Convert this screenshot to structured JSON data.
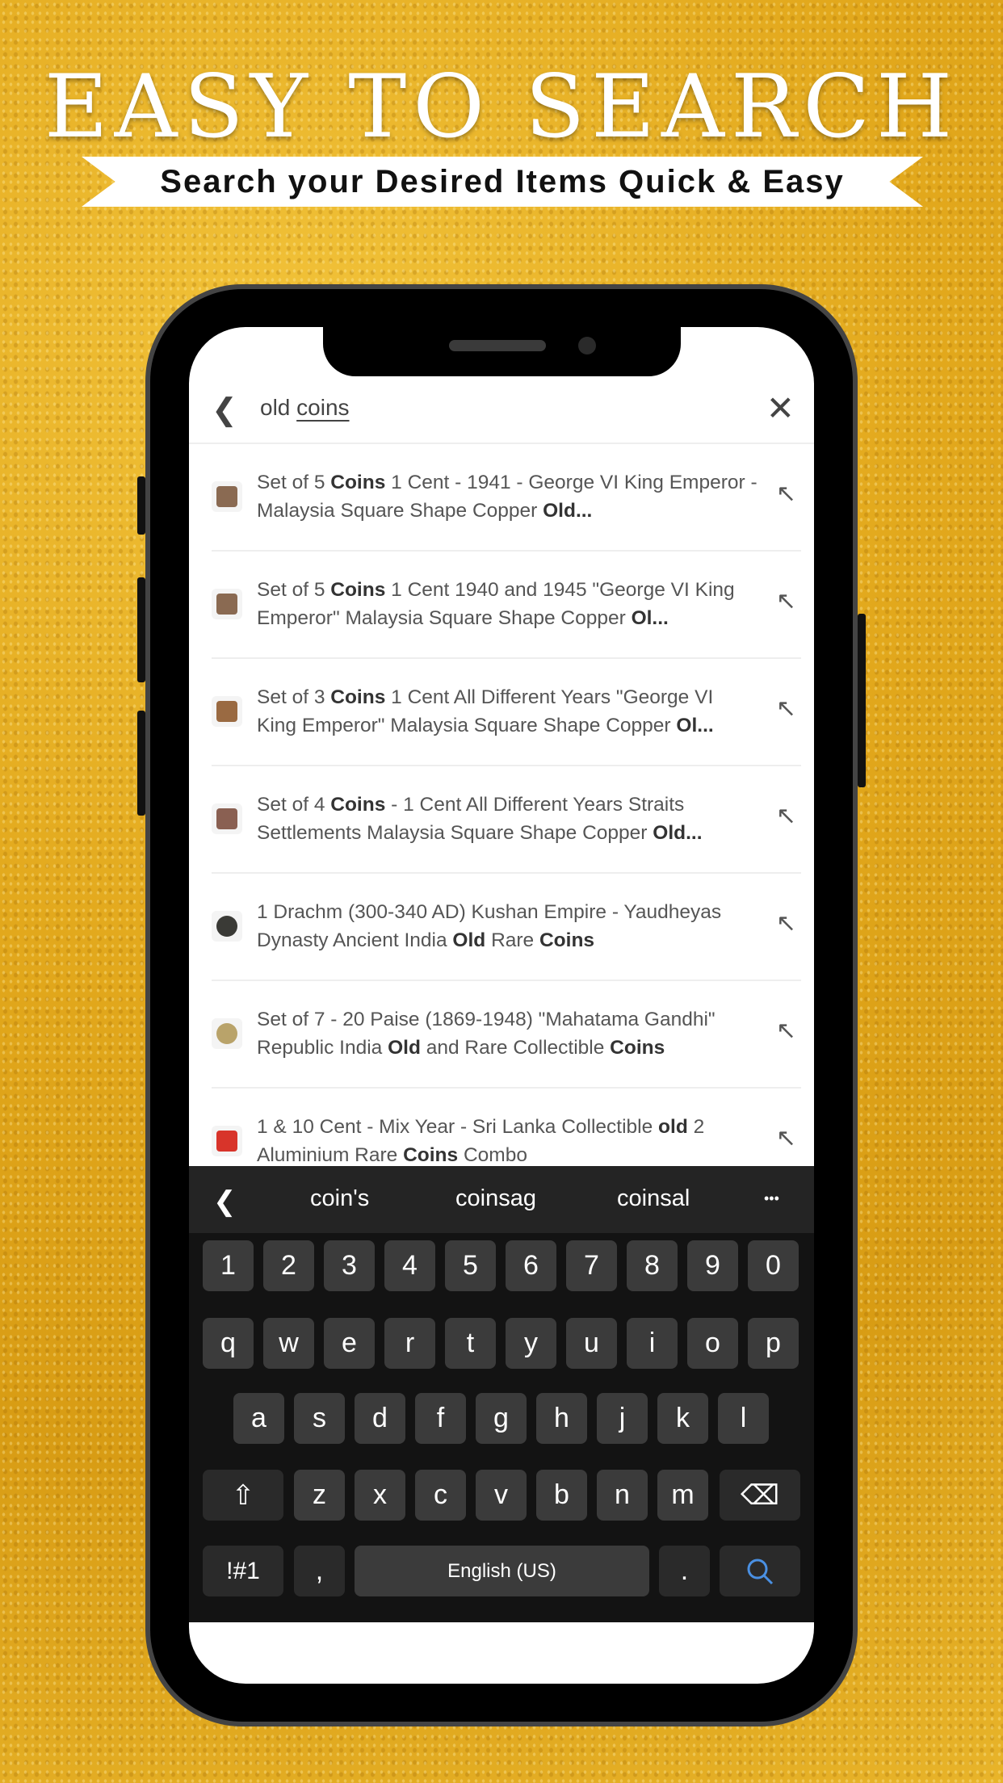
{
  "banner": {
    "title": "EASY TO SEARCH",
    "subtitle": "Search your Desired Items Quick & Easy"
  },
  "search": {
    "query_prefix": "old ",
    "query_underlined": "coins",
    "back_icon": "chevron-left-icon",
    "clear_icon": "close-icon"
  },
  "results": [
    {
      "thumb": "#8a6a52",
      "parts": [
        [
          "Set of 5 ",
          0
        ],
        [
          "Coins",
          1
        ],
        [
          " 1 Cent - 1941 - George VI King Emperor - Malaysia Square Shape Copper ",
          0
        ],
        [
          "Old...",
          1
        ]
      ]
    },
    {
      "thumb": "#8a6a52",
      "parts": [
        [
          "Set of 5 ",
          0
        ],
        [
          "Coins",
          1
        ],
        [
          " 1 Cent 1940 and 1945 \"George VI King Emperor\" Malaysia Square Shape Copper ",
          0
        ],
        [
          "Ol...",
          1
        ]
      ]
    },
    {
      "thumb": "#9a6a42",
      "parts": [
        [
          "Set of 3 ",
          0
        ],
        [
          "Coins",
          1
        ],
        [
          " 1 Cent All Different Years \"George VI King Emperor\" Malaysia Square Shape Copper ",
          0
        ],
        [
          "Ol...",
          1
        ]
      ]
    },
    {
      "thumb": "#8a6052",
      "parts": [
        [
          "Set of 4 ",
          0
        ],
        [
          "Coins",
          1
        ],
        [
          " - 1 Cent All Different Years Straits Settlements Malaysia Square Shape Copper ",
          0
        ],
        [
          "Old...",
          1
        ]
      ]
    },
    {
      "thumb": "#3a3a36",
      "parts": [
        [
          "1 Drachm (300-340 AD) Kushan Empire - Yaudheyas Dynasty Ancient India ",
          0
        ],
        [
          "Old",
          1
        ],
        [
          " Rare ",
          0
        ],
        [
          "Coins",
          1
        ]
      ]
    },
    {
      "thumb": "#b9a36a",
      "parts": [
        [
          "Set of 7 - 20 Paise (1869-1948) \"Mahatama Gandhi\" Republic India ",
          0
        ],
        [
          "Old",
          1
        ],
        [
          " and Rare Collectible ",
          0
        ],
        [
          "Coins",
          1
        ]
      ]
    },
    {
      "thumb": "#d8342a",
      "parts": [
        [
          "1 & 10 Cent - Mix Year - Sri Lanka Collectible ",
          0
        ],
        [
          "old",
          1
        ],
        [
          " 2 Aluminium Rare ",
          0
        ],
        [
          "Coins",
          1
        ],
        [
          " Combo",
          0
        ]
      ]
    }
  ],
  "keyboard": {
    "suggestions": [
      "coin's",
      "coinsag",
      "coinsal"
    ],
    "more": "•••",
    "rows": [
      [
        "1",
        "2",
        "3",
        "4",
        "5",
        "6",
        "7",
        "8",
        "9",
        "0"
      ],
      [
        "q",
        "w",
        "e",
        "r",
        "t",
        "y",
        "u",
        "i",
        "o",
        "p"
      ],
      [
        "a",
        "s",
        "d",
        "f",
        "g",
        "h",
        "j",
        "k",
        "l"
      ],
      [
        "z",
        "x",
        "c",
        "v",
        "b",
        "n",
        "m"
      ]
    ],
    "shift": "⇧",
    "backspace": "⌫",
    "symbols": "!#1",
    "comma": ",",
    "space": "English (US)",
    "period": ".",
    "search_icon": "search-icon"
  }
}
